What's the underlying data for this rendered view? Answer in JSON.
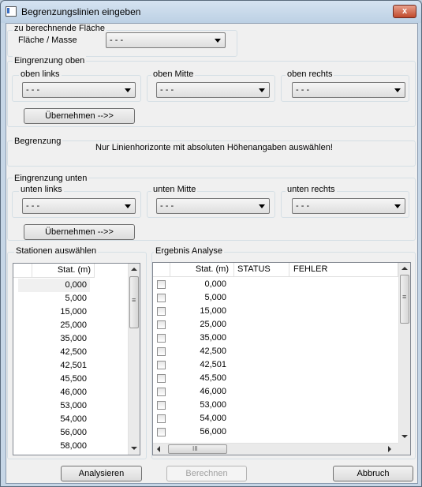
{
  "window": {
    "title": "Begrenzungslinien eingeben",
    "close_glyph": "x"
  },
  "flaeche": {
    "group_label": "zu berechnende Fläche",
    "label": "Fläche / Masse",
    "value": "- - -"
  },
  "oben": {
    "group_label": "Eingrenzung oben",
    "left": {
      "label": "oben links",
      "value": "- - -"
    },
    "middle": {
      "label": "oben Mitte",
      "value": "- - -"
    },
    "right": {
      "label": "oben rechts",
      "value": "- - -"
    },
    "apply_label": "Übernehmen -->>"
  },
  "begrenzung": {
    "label": "Begrenzung",
    "message": "Nur Linienhorizonte mit absoluten Höhenangaben auswählen!"
  },
  "unten": {
    "group_label": "Eingrenzung unten",
    "left": {
      "label": "unten links",
      "value": "- - -"
    },
    "middle": {
      "label": "unten Mitte",
      "value": "- - -"
    },
    "right": {
      "label": "unten rechts",
      "value": "- - -"
    },
    "apply_label": "Übernehmen -->>"
  },
  "stationen": {
    "group_label": "Stationen auswählen",
    "column": "Stat. (m)",
    "rows": [
      "0,000",
      "5,000",
      "15,000",
      "25,000",
      "35,000",
      "42,500",
      "42,501",
      "45,500",
      "46,000",
      "53,000",
      "54,000",
      "56,000",
      "58,000"
    ]
  },
  "ergebnis": {
    "group_label": "Ergebnis Analyse",
    "columns": [
      "Stat. (m)",
      "STATUS",
      "FEHLER"
    ],
    "rows": [
      "0,000",
      "5,000",
      "15,000",
      "25,000",
      "35,000",
      "42,500",
      "42,501",
      "45,500",
      "46,000",
      "53,000",
      "54,000",
      "56,000"
    ],
    "hscroll_grip": "III"
  },
  "buttons": {
    "analyze": "Analysieren",
    "compute": "Berechnen",
    "cancel": "Abbruch"
  },
  "scroll_grip": "≡"
}
